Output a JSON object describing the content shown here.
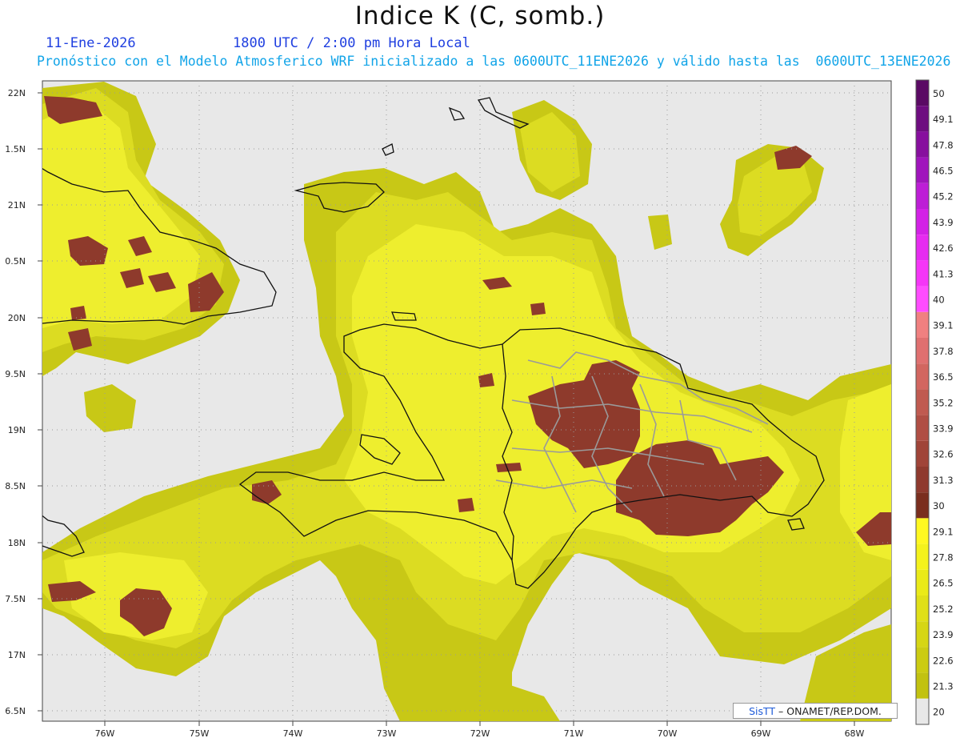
{
  "header": {
    "title": "Indice K (C, somb.)",
    "date": "11-Ene-2026",
    "time": "1800 UTC / 2:00 pm Hora Local",
    "description": "Pronóstico con el Modelo Atmosferico WRF inicializado a las 0600UTC_11ENE2026 y válido hasta las  0600UTC_13ENE2026"
  },
  "axes": {
    "lat_labels": [
      "22N",
      "1.5N",
      "21N",
      "0.5N",
      "20N",
      "9.5N",
      "19N",
      "8.5N",
      "18N",
      "7.5N",
      "17N",
      "6.5N"
    ],
    "lon_labels": [
      "76W",
      "75W",
      "74W",
      "73W",
      "72W",
      "71W",
      "70W",
      "69W",
      "68W"
    ]
  },
  "colorbar": {
    "labels": [
      "50",
      "49.1",
      "47.8",
      "46.5",
      "45.2",
      "43.9",
      "42.6",
      "41.3",
      "40",
      "39.1",
      "37.8",
      "36.5",
      "35.2",
      "33.9",
      "32.6",
      "31.3",
      "30",
      "29.1",
      "27.8",
      "26.5",
      "25.2",
      "23.9",
      "22.6",
      "21.3",
      "20"
    ],
    "colors": [
      "#5a0a64",
      "#6e0d80",
      "#870f9e",
      "#a015bc",
      "#bd1ed6",
      "#d322e6",
      "#e62cf0",
      "#f536f7",
      "#ff4cff",
      "#f08080",
      "#e07070",
      "#d26660",
      "#c05a50",
      "#b04e44",
      "#a04438",
      "#8f3a2e",
      "#7a2e1e",
      "#fff820",
      "#f4f21c",
      "#eaea18",
      "#e0e018",
      "#d6d614",
      "#cccc12",
      "#c2c210",
      "#e8e8e8"
    ]
  },
  "colors": {
    "ocean": "#e8e8e8",
    "k_low": "#c4c414",
    "k_mid": "#dcdc20",
    "k_high": "#f0f030",
    "k_severe": "#8e3a2c",
    "coastline": "#111111",
    "provinces": "#9a9a9a"
  },
  "credit": {
    "logo": "SisTT",
    "text": " – ONAMET/REP.DOM."
  }
}
